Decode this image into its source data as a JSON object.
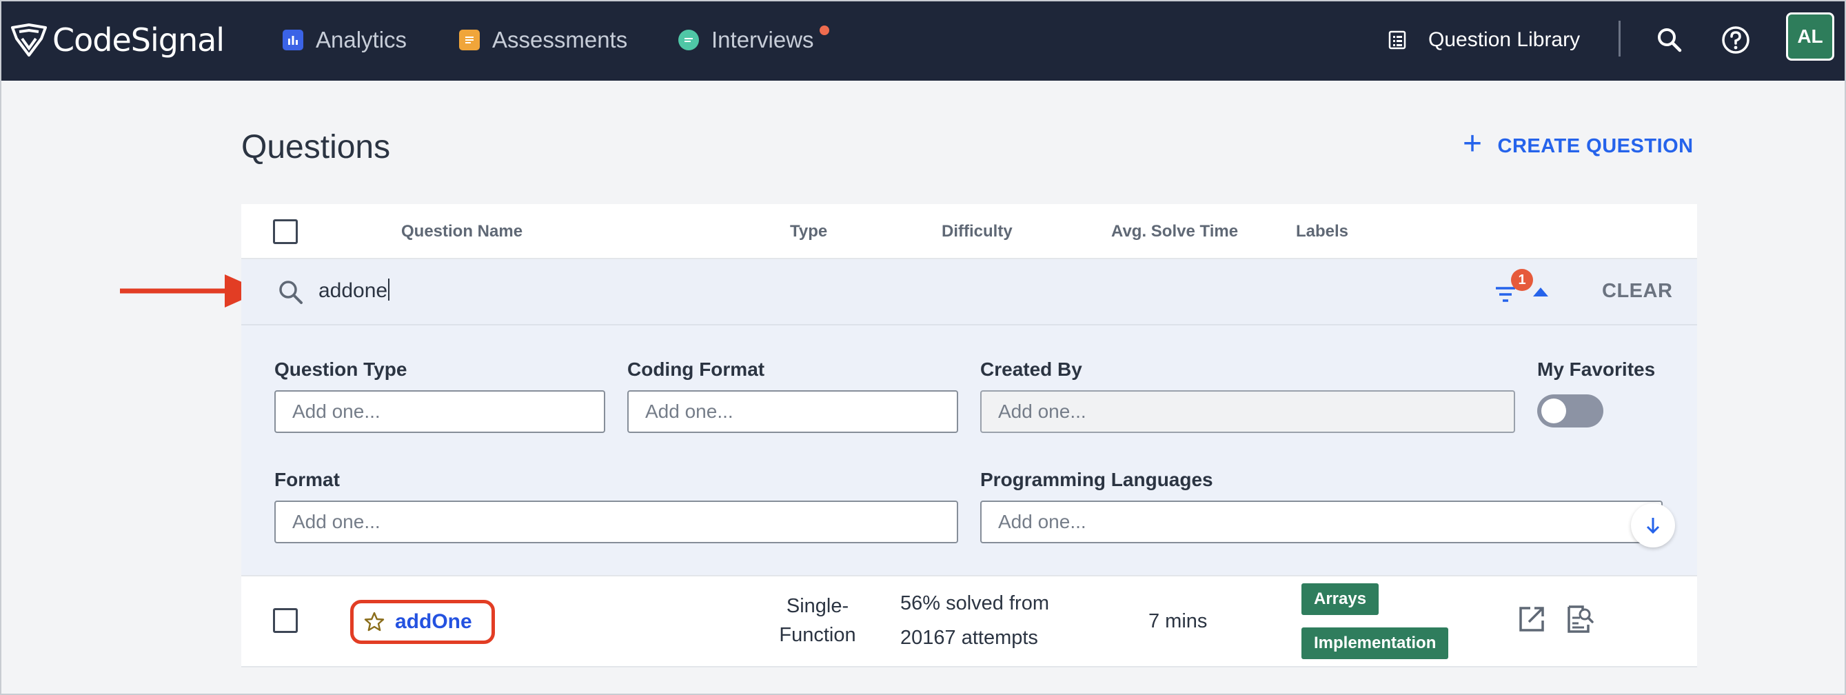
{
  "app": {
    "brand": "CodeSignal",
    "nav": {
      "analytics": "Analytics",
      "assessments": "Assessments",
      "interviews": "Interviews",
      "question_library": "Question Library",
      "avatar_initials": "AL"
    }
  },
  "page": {
    "title": "Questions",
    "create_button": "CREATE QUESTION"
  },
  "table": {
    "headers": {
      "name": "Question Name",
      "type": "Type",
      "difficulty": "Difficulty",
      "avg_time": "Avg. Solve Time",
      "labels": "Labels"
    },
    "search": {
      "value": "addone",
      "filter_count": "1",
      "clear": "CLEAR"
    },
    "filters": {
      "question_type": {
        "label": "Question Type",
        "placeholder": "Add one..."
      },
      "coding_format": {
        "label": "Coding Format",
        "placeholder": "Add one..."
      },
      "created_by": {
        "label": "Created By",
        "placeholder": "Add one..."
      },
      "my_favorites": {
        "label": "My Favorites",
        "enabled": false
      },
      "format": {
        "label": "Format",
        "placeholder": "Add one..."
      },
      "programming_languages": {
        "label": "Programming Languages",
        "placeholder": "Add one..."
      }
    },
    "rows": [
      {
        "name": "addOne",
        "type_line1": "Single-",
        "type_line2": "Function",
        "difficulty_line1": "56% solved from",
        "difficulty_line2": "20167 attempts",
        "avg_time": "7 mins",
        "labels": [
          "Arrays",
          "Implementation"
        ]
      }
    ]
  },
  "colors": {
    "nav_bg": "#1e2639",
    "accent": "#2563eb",
    "tag": "#2f7d5d",
    "highlight": "#e23d24",
    "badge": "#e65a3b"
  }
}
